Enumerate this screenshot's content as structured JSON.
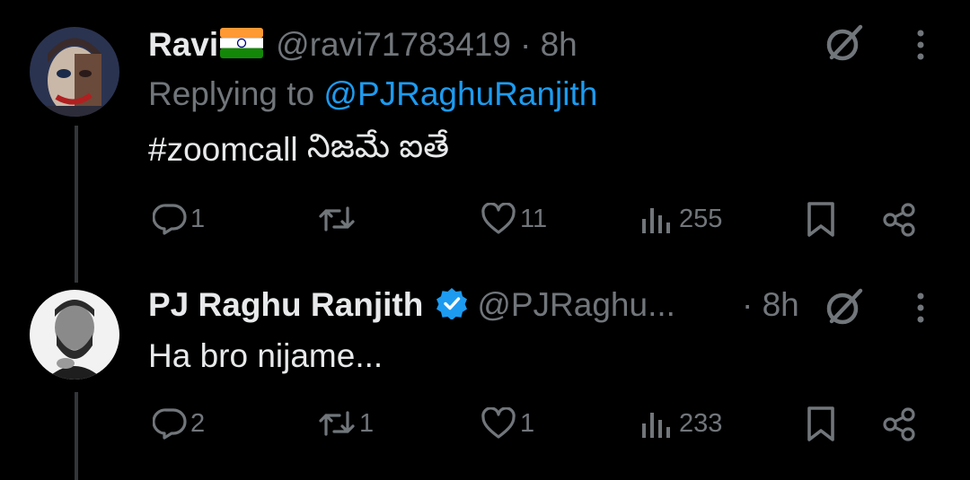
{
  "tweet1": {
    "display_name": "Ravi",
    "flag_icon": "india-flag",
    "handle": "@ravi71783419",
    "time": "· 8h",
    "replying_prefix": "Replying to ",
    "replying_to": "@PJRaghuRanjith",
    "hashtag": "#zoomcall",
    "text": " నిజమే ఐతే",
    "replies": "1",
    "retweets": "",
    "likes": "11",
    "views": "255"
  },
  "tweet2": {
    "display_name": "PJ Raghu Ranjith",
    "verified_icon": "verified-badge",
    "handle": "@PJRaghu...",
    "time": "· 8h",
    "text": "Ha bro nijame...",
    "replies": "2",
    "retweets": "1",
    "likes": "1",
    "views": "233"
  },
  "colors": {
    "background": "#000000",
    "text": "#e7e9ea",
    "muted": "#71767b",
    "accent": "#1d9bf0"
  }
}
